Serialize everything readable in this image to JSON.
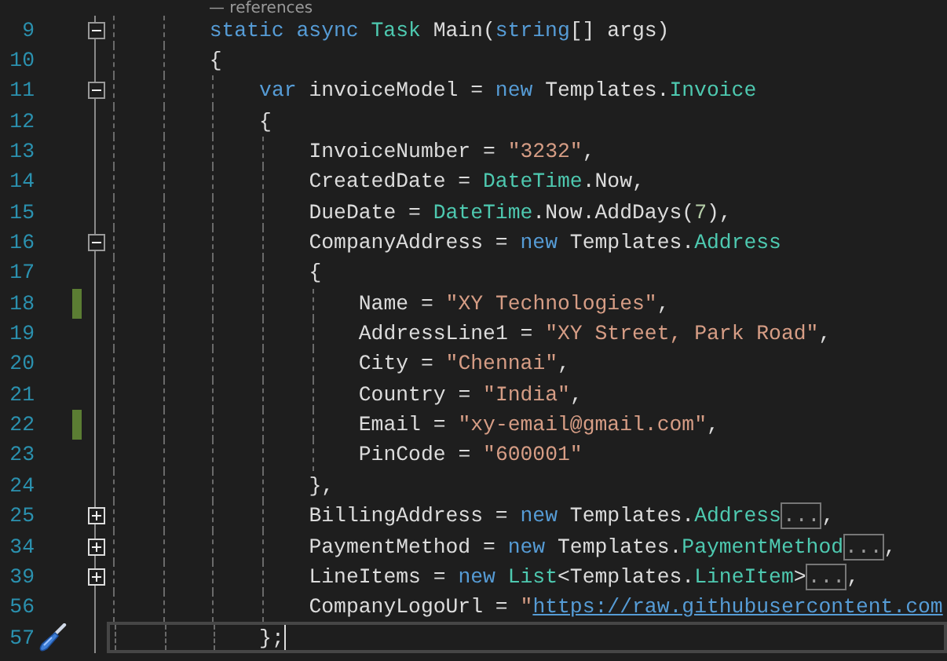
{
  "codelens": "— references",
  "lines": [
    {
      "number": "9",
      "expanded": true,
      "changed": false,
      "current": false,
      "tokens": [
        {
          "kind": "keyword",
          "text": "static async"
        },
        {
          "kind": "type",
          "text": " Task"
        },
        {
          "kind": "plain",
          "text": " Main("
        },
        {
          "kind": "keyword",
          "text": "string"
        },
        {
          "kind": "plain",
          "text": "[] args)"
        }
      ]
    },
    {
      "number": "10",
      "changed": false,
      "current": false,
      "tokens": [
        {
          "kind": "plain",
          "text": "{"
        }
      ],
      "children": [
        {
          "number": "11",
          "expanded": true,
          "changed": false,
          "current": false,
          "tokens": [
            {
              "kind": "keyword",
              "text": "var"
            },
            {
              "kind": "plain",
              "text": " invoiceModel = "
            },
            {
              "kind": "keyword",
              "text": "new"
            },
            {
              "kind": "plain",
              "text": " Templates."
            },
            {
              "kind": "type",
              "text": "Invoice"
            }
          ]
        },
        {
          "number": "12",
          "changed": false,
          "current": false,
          "tokens": [
            {
              "kind": "plain",
              "text": "{"
            }
          ],
          "children": [
            {
              "number": "13",
              "changed": false,
              "current": false,
              "tokens": [
                {
                  "kind": "plain",
                  "text": "InvoiceNumber = "
                },
                {
                  "kind": "string",
                  "text": "\"3232\""
                },
                {
                  "kind": "plain",
                  "text": ","
                }
              ]
            },
            {
              "number": "14",
              "changed": false,
              "current": false,
              "tokens": [
                {
                  "kind": "plain",
                  "text": "CreatedDate = "
                },
                {
                  "kind": "type",
                  "text": "DateTime"
                },
                {
                  "kind": "plain",
                  "text": ".Now,"
                }
              ]
            },
            {
              "number": "15",
              "changed": false,
              "current": false,
              "tokens": [
                {
                  "kind": "plain",
                  "text": "DueDate = "
                },
                {
                  "kind": "type",
                  "text": "DateTime"
                },
                {
                  "kind": "plain",
                  "text": ".Now.AddDays("
                },
                {
                  "kind": "number",
                  "text": "7"
                },
                {
                  "kind": "plain",
                  "text": "),"
                }
              ]
            },
            {
              "number": "16",
              "expanded": true,
              "changed": false,
              "current": false,
              "tokens": [
                {
                  "kind": "plain",
                  "text": "CompanyAddress = "
                },
                {
                  "kind": "keyword",
                  "text": "new"
                },
                {
                  "kind": "plain",
                  "text": " Templates."
                },
                {
                  "kind": "type",
                  "text": "Address"
                }
              ]
            },
            {
              "number": "17",
              "changed": false,
              "current": false,
              "tokens": [
                {
                  "kind": "plain",
                  "text": "{"
                }
              ],
              "children": [
                {
                  "number": "18",
                  "changed": true,
                  "current": false,
                  "tokens": [
                    {
                      "kind": "plain",
                      "text": "Name = "
                    },
                    {
                      "kind": "string",
                      "text": "\"XY Technologies\""
                    },
                    {
                      "kind": "plain",
                      "text": ","
                    }
                  ]
                },
                {
                  "number": "19",
                  "changed": false,
                  "current": false,
                  "tokens": [
                    {
                      "kind": "plain",
                      "text": "AddressLine1 = "
                    },
                    {
                      "kind": "string",
                      "text": "\"XY Street, Park Road\""
                    },
                    {
                      "kind": "plain",
                      "text": ","
                    }
                  ]
                },
                {
                  "number": "20",
                  "changed": false,
                  "current": false,
                  "tokens": [
                    {
                      "kind": "plain",
                      "text": "City = "
                    },
                    {
                      "kind": "string",
                      "text": "\"Chennai\""
                    },
                    {
                      "kind": "plain",
                      "text": ","
                    }
                  ]
                },
                {
                  "number": "21",
                  "changed": false,
                  "current": false,
                  "tokens": [
                    {
                      "kind": "plain",
                      "text": "Country = "
                    },
                    {
                      "kind": "string",
                      "text": "\"India\""
                    },
                    {
                      "kind": "plain",
                      "text": ","
                    }
                  ]
                },
                {
                  "number": "22",
                  "changed": true,
                  "current": false,
                  "tokens": [
                    {
                      "kind": "plain",
                      "text": "Email = "
                    },
                    {
                      "kind": "string",
                      "text": "\"xy-email@gmail.com\""
                    },
                    {
                      "kind": "plain",
                      "text": ","
                    }
                  ]
                },
                {
                  "number": "23",
                  "changed": false,
                  "current": false,
                  "tokens": [
                    {
                      "kind": "plain",
                      "text": "PinCode = "
                    },
                    {
                      "kind": "string",
                      "text": "\"600001\""
                    }
                  ]
                }
              ]
            },
            {
              "number": "24",
              "changed": false,
              "current": false,
              "tokens": [
                {
                  "kind": "plain",
                  "text": "},"
                }
              ]
            },
            {
              "number": "25",
              "expanded": false,
              "changed": false,
              "current": false,
              "tokens": [
                {
                  "kind": "plain",
                  "text": "BillingAddress = "
                },
                {
                  "kind": "keyword",
                  "text": "new"
                },
                {
                  "kind": "plain",
                  "text": " Templates."
                },
                {
                  "kind": "type",
                  "text": "Address"
                },
                {
                  "kind": "collapsed",
                  "text": "..."
                },
                {
                  "kind": "plain",
                  "text": ","
                }
              ]
            },
            {
              "number": "34",
              "expanded": false,
              "changed": false,
              "current": false,
              "tokens": [
                {
                  "kind": "plain",
                  "text": "PaymentMethod = "
                },
                {
                  "kind": "keyword",
                  "text": "new"
                },
                {
                  "kind": "plain",
                  "text": " Templates."
                },
                {
                  "kind": "type",
                  "text": "PaymentMethod"
                },
                {
                  "kind": "collapsed",
                  "text": "..."
                },
                {
                  "kind": "plain",
                  "text": ","
                }
              ]
            },
            {
              "number": "39",
              "expanded": false,
              "changed": false,
              "current": false,
              "tokens": [
                {
                  "kind": "plain",
                  "text": "LineItems = "
                },
                {
                  "kind": "keyword",
                  "text": "new"
                },
                {
                  "kind": "type",
                  "text": " List"
                },
                {
                  "kind": "plain",
                  "text": "<Templates."
                },
                {
                  "kind": "type",
                  "text": "LineItem"
                },
                {
                  "kind": "plain",
                  "text": ">"
                },
                {
                  "kind": "collapsed",
                  "text": "..."
                },
                {
                  "kind": "plain",
                  "text": ","
                }
              ]
            },
            {
              "number": "56",
              "changed": false,
              "current": false,
              "tokens": [
                {
                  "kind": "plain",
                  "text": "CompanyLogoUrl = "
                },
                {
                  "kind": "string",
                  "text": "\""
                },
                {
                  "kind": "link",
                  "text": "https://raw.githubusercontent.com"
                }
              ]
            }
          ]
        },
        {
          "number": "57",
          "changed": false,
          "current": true,
          "tokens": [
            {
              "kind": "plain",
              "text": "};"
            }
          ]
        }
      ]
    }
  ]
}
